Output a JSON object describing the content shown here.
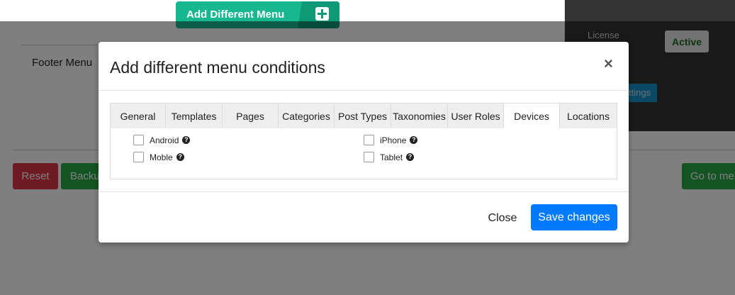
{
  "background": {
    "add_menu_button_label": "Add Different Menu",
    "footer_menu_label": "Footer Menu",
    "license_label": "License",
    "license_status": "Active",
    "settings_button_label": "ttings",
    "reset_label": "Reset",
    "backup_label": "Backup",
    "goto_label": "Go to me"
  },
  "modal": {
    "title": "Add different menu conditions",
    "close_symbol": "×",
    "tabs": [
      {
        "label": "General"
      },
      {
        "label": "Templates"
      },
      {
        "label": "Pages"
      },
      {
        "label": "Categories"
      },
      {
        "label": "Post Types"
      },
      {
        "label": "Taxonomies"
      },
      {
        "label": "User Roles"
      },
      {
        "label": "Devices"
      },
      {
        "label": "Locations"
      }
    ],
    "active_tab": "Devices",
    "devices": {
      "android": "Android",
      "iphone": "iPhone",
      "mobile": "Moble",
      "tablet": "Tablet"
    },
    "help_glyph": "?",
    "footer": {
      "close_label": "Close",
      "save_label": "Save changes"
    }
  },
  "colors": {
    "primary": "#007bff",
    "success": "#28a745",
    "danger": "#dc3545",
    "teal": "#17b890"
  }
}
